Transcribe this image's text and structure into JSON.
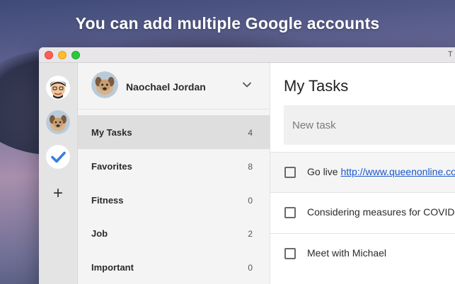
{
  "headline": "You can add multiple Google accounts",
  "window": {
    "title": "T"
  },
  "accounts": {
    "items": [
      {
        "name": "emoji-avatar"
      },
      {
        "name": "dog-avatar"
      },
      {
        "name": "tasks-app-avatar"
      }
    ],
    "add_label": "+"
  },
  "profile": {
    "name": "Naochael Jordan"
  },
  "lists": [
    {
      "label": "My Tasks",
      "count": "4",
      "selected": true
    },
    {
      "label": "Favorites",
      "count": "8"
    },
    {
      "label": "Fitness",
      "count": "0"
    },
    {
      "label": "Job",
      "count": "2"
    },
    {
      "label": "Important",
      "count": "0"
    }
  ],
  "main": {
    "title": "My Tasks",
    "new_task_placeholder": "New task",
    "tasks": [
      {
        "prefix": "Go live ",
        "link": "http://www.queenonline.com"
      },
      {
        "text": "Considering measures for COVID"
      },
      {
        "text": "Meet with Michael"
      }
    ]
  },
  "colors": {
    "accent_blue": "#3b7be0",
    "selected_bg": "#dedede",
    "link": "#1a56c9"
  }
}
